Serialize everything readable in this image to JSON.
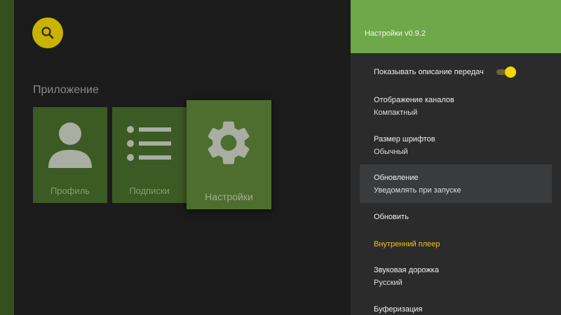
{
  "app": {
    "section_title": "Приложение",
    "tiles": [
      {
        "label": "Профиль",
        "icon": "person-icon"
      },
      {
        "label": "Подписки",
        "icon": "list-icon"
      },
      {
        "label": "Настройки",
        "icon": "gear-icon"
      }
    ],
    "search_icon": "search-icon"
  },
  "settings": {
    "title": "Настройки v0.9.2",
    "items": [
      {
        "label": "Показывать описание передач",
        "toggle": true
      },
      {
        "label": "Отображение каналов",
        "value": "Компактный"
      },
      {
        "label": "Размер шрифтов",
        "value": "Обычный"
      },
      {
        "label": "Обновление",
        "value": "Уведомлять при запуске",
        "selected": true
      },
      {
        "label": "Обновить"
      },
      {
        "label": "Внутренний плеер",
        "accent": true
      },
      {
        "label": "Звуковая дорожка",
        "value": "Русский"
      },
      {
        "label": "Буферизация"
      }
    ]
  },
  "colors": {
    "accent_yellow": "#f0c419",
    "header_green": "#6fa84a",
    "tile_green": "#3c5a24"
  }
}
